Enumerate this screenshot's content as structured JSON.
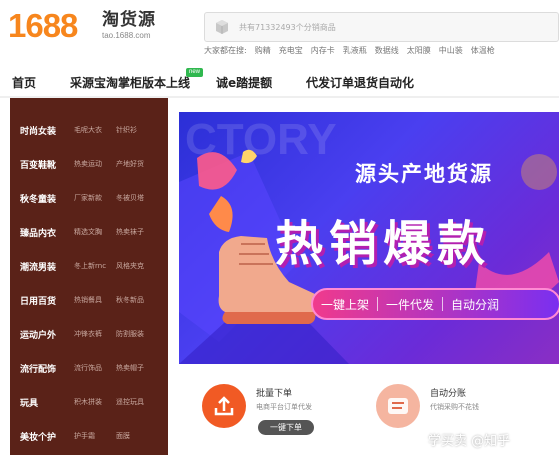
{
  "header": {
    "logo_text": "1688",
    "brand_name": "淘货源",
    "brand_url": "tao.1688.com",
    "search_placeholder": "共有71332493个分销商品",
    "hot_words": [
      "大家都在搜:",
      "购精",
      "充电宝",
      "内存卡",
      "乳液瓶",
      "数据线",
      "太阳膜",
      "中山装",
      "体温枪"
    ]
  },
  "nav": {
    "items": [
      "首页",
      "采源宝淘掌柜版本上线",
      "诚e踏提额",
      "代发订单退货自动化"
    ],
    "badge": "new"
  },
  "sidebar": {
    "categories": [
      {
        "main": "时尚女装",
        "subs": [
          "毛呢大衣",
          "针织衫"
        ]
      },
      {
        "main": "百变鞋靴",
        "subs": [
          "热卖运动",
          "产地好货"
        ]
      },
      {
        "main": "秋冬童装",
        "subs": [
          "厂家新款",
          "冬被贝塔"
        ]
      },
      {
        "main": "臻品内衣",
        "subs": [
          "精选文胸",
          "热卖袜子"
        ]
      },
      {
        "main": "潮流男装",
        "subs": [
          "冬上新rnc",
          "风格夹克"
        ]
      },
      {
        "main": "日用百货",
        "subs": [
          "热销餐具",
          "秋冬新品"
        ]
      },
      {
        "main": "运动户外",
        "subs": [
          "冲锋衣裤",
          "防割服装"
        ]
      },
      {
        "main": "流行配饰",
        "subs": [
          "流行饰品",
          "热卖帽子"
        ]
      },
      {
        "main": "玩具",
        "subs": [
          "积木拼装",
          "遥控玩具"
        ]
      },
      {
        "main": "美妆个护",
        "subs": [
          "护手霜",
          "面膜"
        ]
      }
    ]
  },
  "banner": {
    "bg_text": "CTORY",
    "title": "源头产地货源",
    "big_title": "热销爆款",
    "features": [
      "一键上架",
      "一件代发",
      "自动分润"
    ],
    "accent_color": "#4a3ff0"
  },
  "services": [
    {
      "title": "批量下单",
      "desc": "电商平台订单代发",
      "button": "一键下单",
      "color": "#f15a24"
    },
    {
      "title": "自动分账",
      "desc": "代销采购不花钱",
      "button": "",
      "color": "#f5b5a0"
    }
  ],
  "watermark": "学买卖 @知乎"
}
